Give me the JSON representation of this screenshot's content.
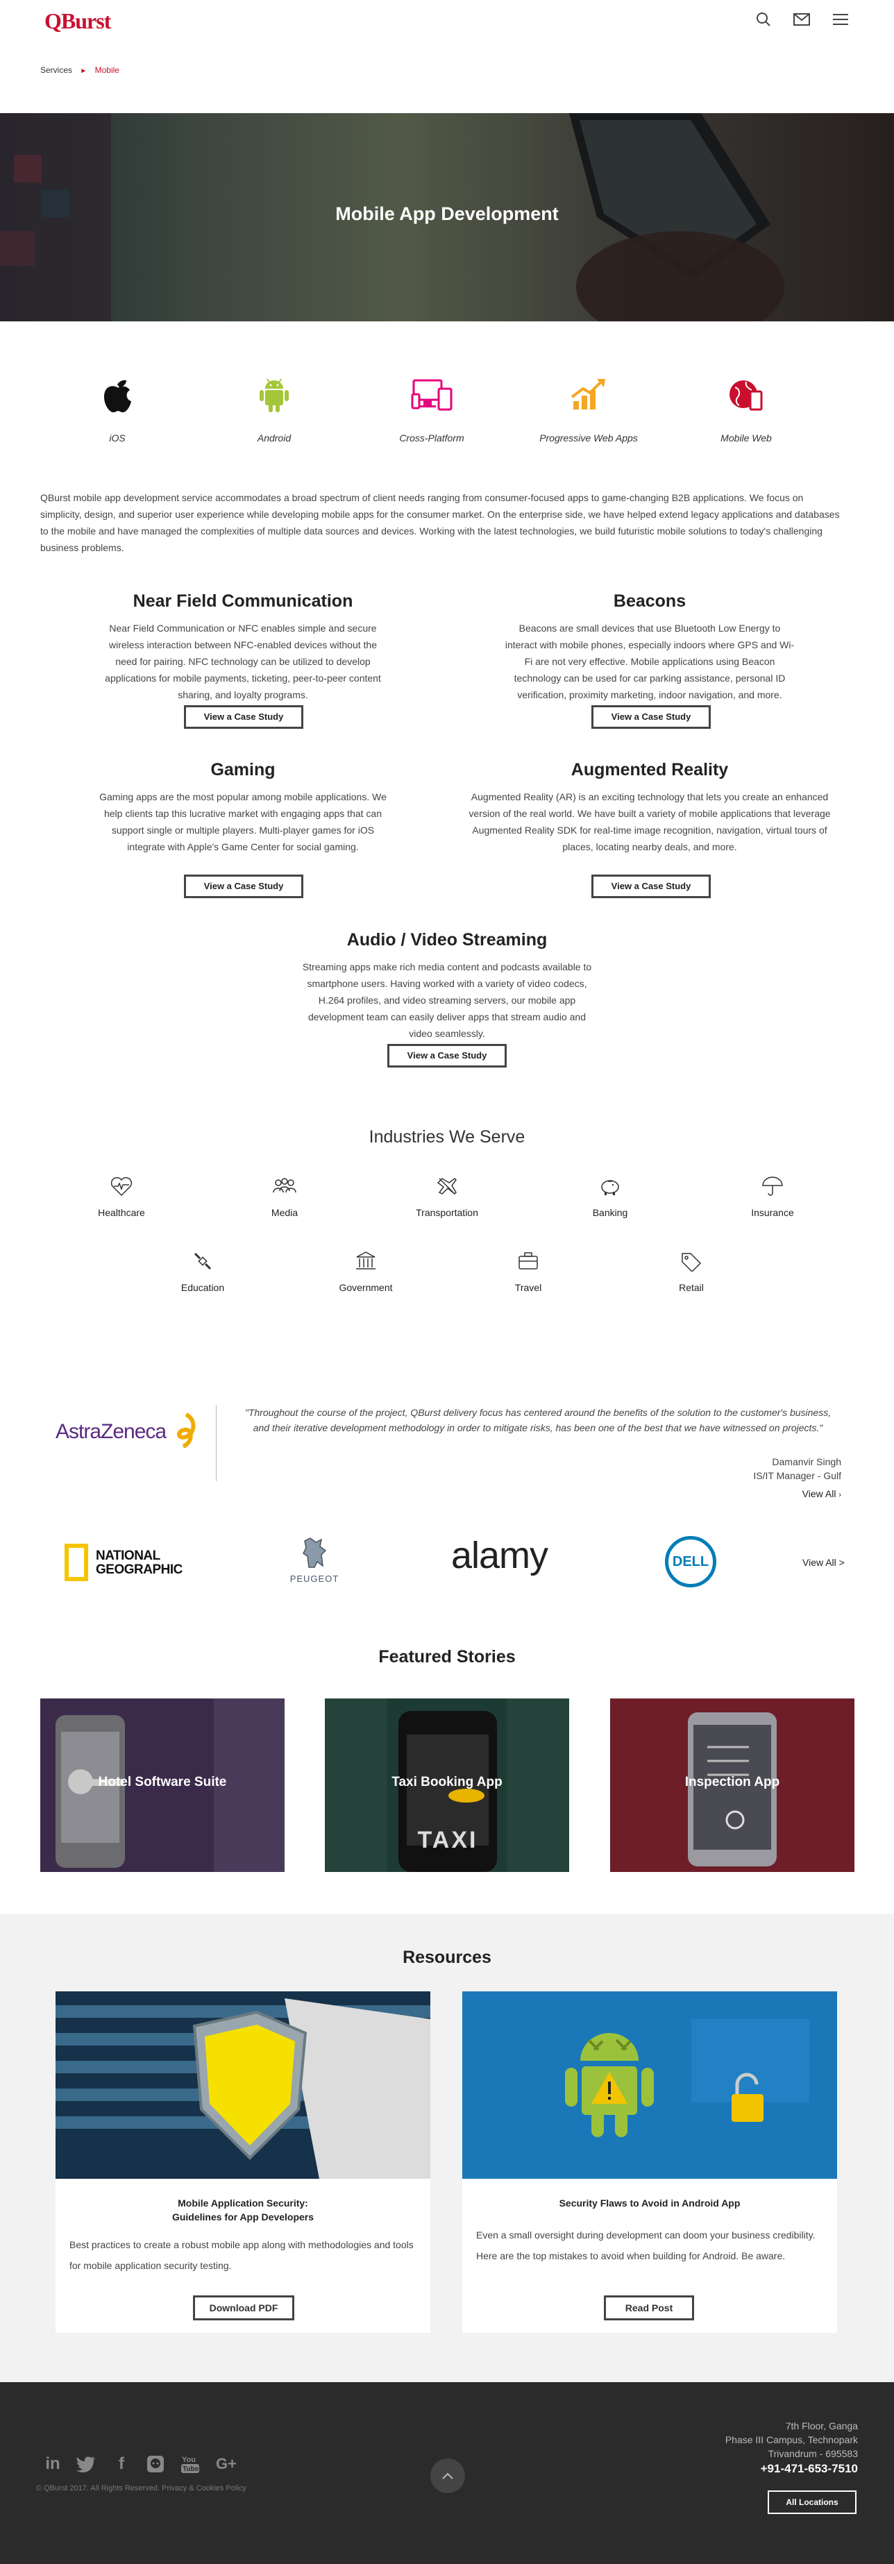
{
  "header": {
    "logo": "QBurst"
  },
  "breadcrumb": {
    "parent": "Services",
    "current": "Mobile"
  },
  "hero": {
    "title": "Mobile App Development"
  },
  "platforms": [
    {
      "label": "iOS"
    },
    {
      "label": "Android"
    },
    {
      "label": "Cross-Platform"
    },
    {
      "label": "Progressive Web Apps"
    },
    {
      "label": "Mobile Web"
    }
  ],
  "intro": "QBurst mobile app development service accommodates a broad spectrum of client needs ranging from consumer-focused apps to game-changing B2B applications. We focus on simplicity, design, and superior user experience while developing mobile apps for the consumer market. On the enterprise side, we have helped extend legacy applications and databases to the mobile and have managed the complexities of multiple data sources and devices. Working with the latest technologies, we build futuristic mobile solutions to today's challenging business problems.",
  "features": [
    {
      "title": "Near Field Communication",
      "text": "Near Field Communication or NFC enables simple and secure wireless interaction between NFC-enabled devices without the need for pairing. NFC technology can be utilized to develop applications for mobile payments, ticketing, peer-to-peer content sharing, and loyalty programs.",
      "button": "View a Case Study"
    },
    {
      "title": "Beacons",
      "text": "Beacons are small devices that use Bluetooth Low Energy to interact with mobile phones, especially indoors where GPS and Wi-Fi are not very effective. Mobile applications using Beacon technology can be used for car parking assistance, personal ID verification, proximity marketing, indoor navigation, and more.",
      "button": "View a Case Study"
    },
    {
      "title": "Gaming",
      "text": "Gaming apps are the most popular among mobile applications. We help clients tap this lucrative market with engaging apps that can support single or multiple players. Multi-player games for iOS integrate with Apple's Game Center for social gaming.",
      "button": "View a Case Study"
    },
    {
      "title": "Augmented Reality",
      "text": "Augmented Reality (AR) is an exciting technology that lets you create an enhanced version of the real world. We have built a variety of mobile applications that leverage Augmented Reality SDK for real-time image recognition, navigation, virtual tours of places, locating nearby deals, and more.",
      "button": "View a Case Study"
    },
    {
      "title": "Audio / Video Streaming",
      "text": "Streaming apps make rich media content and podcasts available to smartphone users. Having worked with a variety of video codecs, H.264 profiles, and video streaming servers, our mobile app development team can easily deliver apps that stream audio and video seamlessly.",
      "button": "View a Case Study"
    }
  ],
  "industries": {
    "title": "Industries We Serve",
    "items": [
      {
        "label": "Healthcare"
      },
      {
        "label": "Media"
      },
      {
        "label": "Transportation"
      },
      {
        "label": "Banking"
      },
      {
        "label": "Insurance"
      },
      {
        "label": "Education"
      },
      {
        "label": "Government"
      },
      {
        "label": "Travel"
      },
      {
        "label": "Retail"
      }
    ]
  },
  "testimonial": {
    "company": "AstraZeneca",
    "quote": "\"Throughout the course of the project, QBurst delivery focus has centered around the benefits of the solution to the customer's business, and their iterative development methodology in order to mitigate risks, has been one of the best that we have witnessed on projects.\"",
    "author": "Damanvir Singh",
    "role": "IS/IT Manager - Gulf",
    "view_all": "View All"
  },
  "clients": {
    "nat_geo_1": "NATIONAL",
    "nat_geo_2": "GEOGRAPHIC",
    "peugeot": "PEUGEOT",
    "alamy": "alamy",
    "dell": "DELL",
    "view_all": "View All >"
  },
  "featured": {
    "title": "Featured Stories",
    "items": [
      {
        "title": "Hotel Software Suite"
      },
      {
        "title": "Taxi Booking App",
        "sign": "TAXI"
      },
      {
        "title": "Inspection App"
      }
    ]
  },
  "resources": {
    "title": "Resources",
    "items": [
      {
        "title_1": "Mobile Application Security:",
        "title_2": "Guidelines for App Developers",
        "text": "Best practices to create a robust mobile app along with methodologies and tools for mobile application security testing.",
        "button": "Download PDF"
      },
      {
        "title_1": "Security Flaws to Avoid in Android App",
        "text": "Even a small oversight during development can doom your business credibility. Here are the top mistakes to avoid when building for Android. Be aware.",
        "button": "Read Post"
      }
    ]
  },
  "footer": {
    "address_1": "7th Floor, Ganga",
    "address_2": "Phase III Campus, Technopark",
    "address_3": "Trivandrum - 695583",
    "phone": "+91-471-653-7510",
    "locations": "All Locations",
    "copyright": "© QBurst 2017. All Rights Reserved. Privacy & Cookies Policy"
  },
  "colors": {
    "brand": "#c8102e",
    "android": "#a4c639",
    "pink": "#e6007e",
    "orange": "#f5a623",
    "footer": "#2b2b2b"
  }
}
